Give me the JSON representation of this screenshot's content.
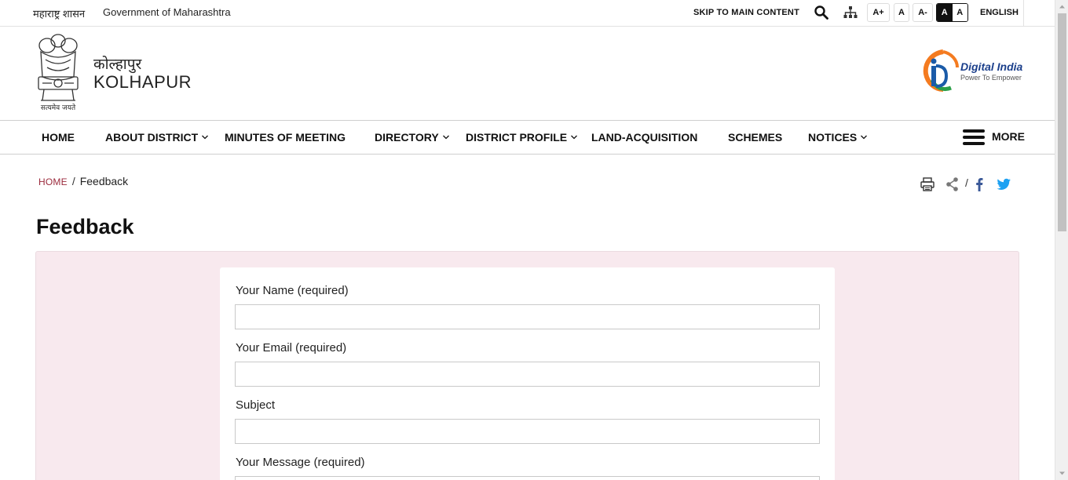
{
  "topbar": {
    "gov_hindi": "महाराष्ट्र शासन",
    "gov_english": "Government of Maharashtra",
    "skip": "SKIP TO MAIN CONTENT",
    "font_increase": "A+",
    "font_normal": "A",
    "font_decrease": "A-",
    "contrast_dark": "A",
    "contrast_light": "A",
    "language": "ENGLISH"
  },
  "header": {
    "emblem_motto": "सत्यमेव जयते",
    "site_hindi": "कोल्हापुर",
    "site_english": "KOLHAPUR",
    "digital_title": "Digital India",
    "digital_tagline": "Power To Empower"
  },
  "nav": {
    "items": [
      {
        "label": "HOME"
      },
      {
        "label": "ABOUT DISTRICT"
      },
      {
        "label": "MINUTES OF MEETING"
      },
      {
        "label": "DIRECTORY"
      },
      {
        "label": "DISTRICT PROFILE"
      },
      {
        "label": "LAND-ACQUISITION"
      },
      {
        "label": "SCHEMES"
      },
      {
        "label": "NOTICES"
      }
    ],
    "more": "MORE"
  },
  "breadcrumb": {
    "home": "HOME",
    "separator": "/",
    "current": "Feedback"
  },
  "tools": {
    "slash": "/"
  },
  "page": {
    "title": "Feedback"
  },
  "form": {
    "name_label": "Your Name (required)",
    "email_label": "Your Email (required)",
    "subject_label": "Subject",
    "message_label": "Your Message (required)",
    "name_value": "",
    "email_value": "",
    "subject_value": ""
  },
  "colors": {
    "breadcrumb_home": "#9b2a3c",
    "panel_background": "#f8e9ee",
    "twitter": "#1da1f2",
    "facebook": "#3b5998"
  }
}
